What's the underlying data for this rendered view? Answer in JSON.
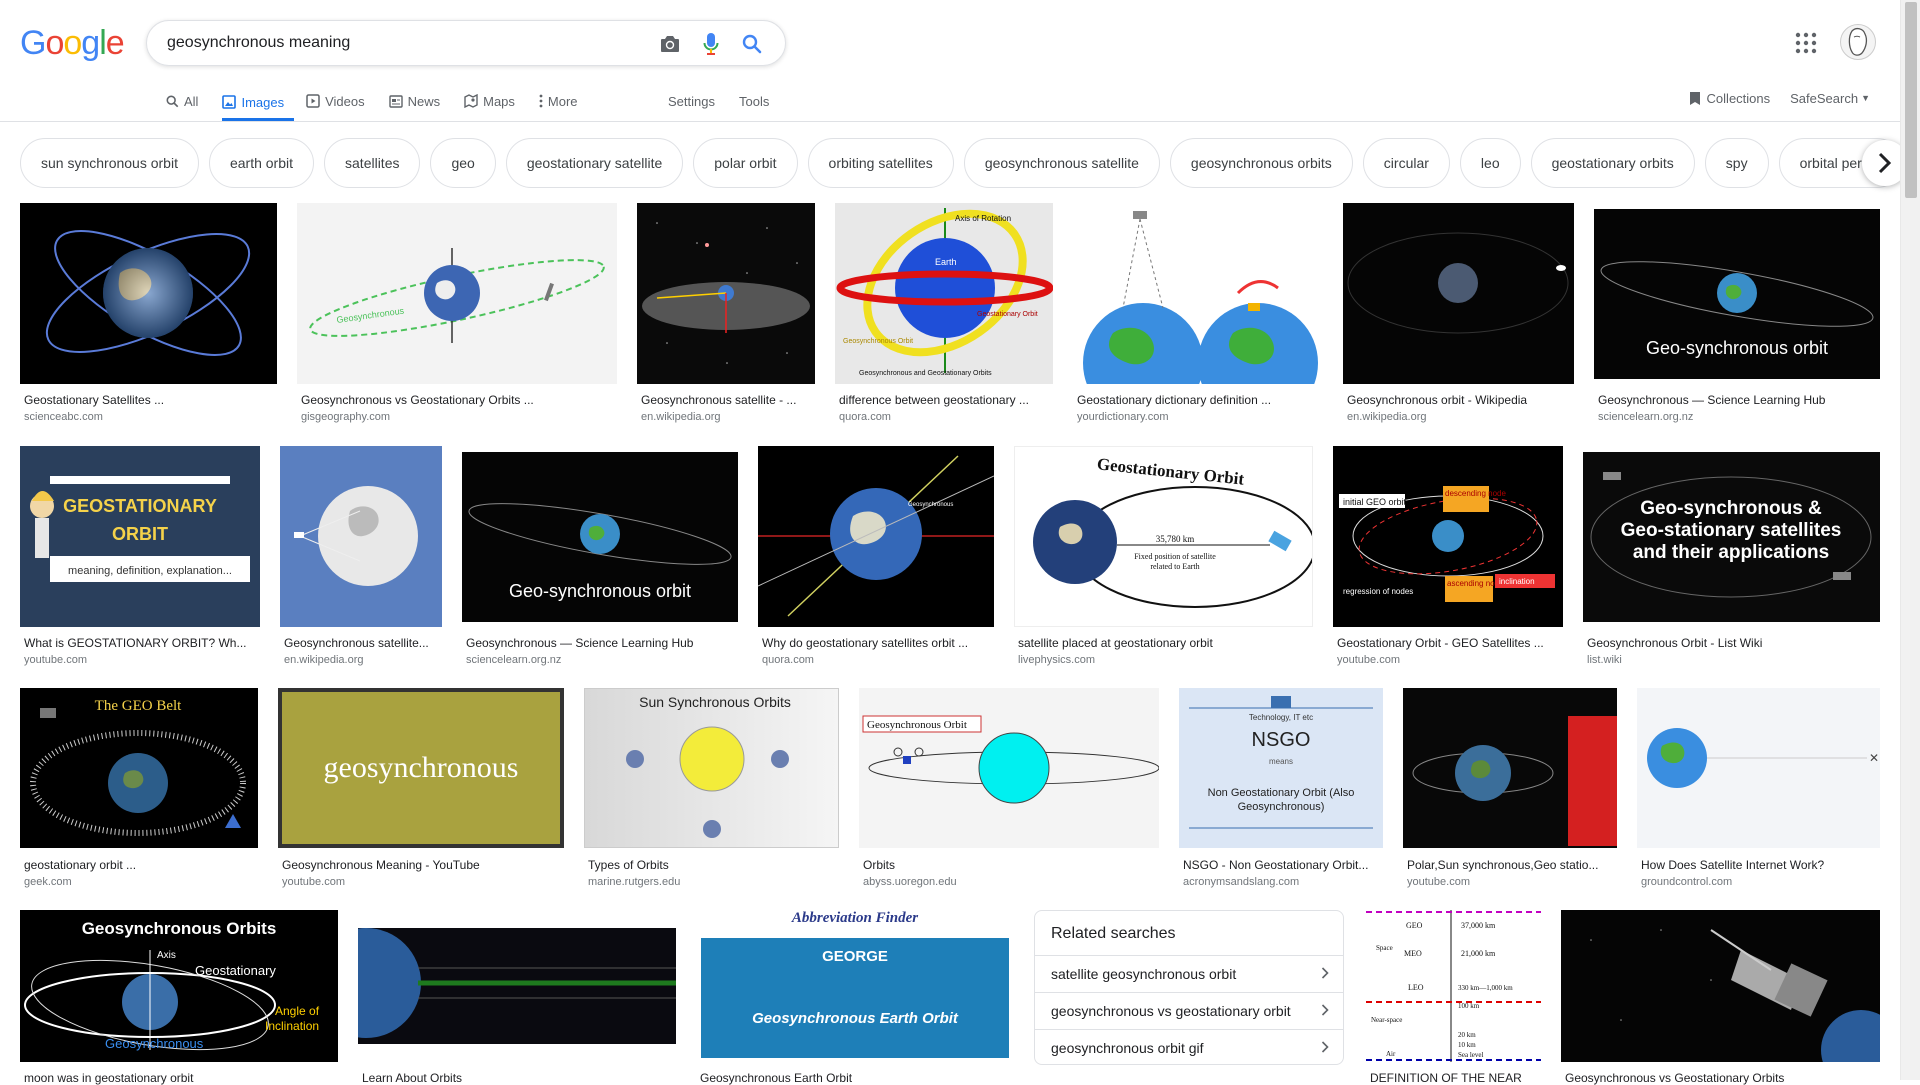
{
  "logo": {
    "letters": [
      "G",
      "o",
      "o",
      "g",
      "l",
      "e"
    ]
  },
  "search": {
    "query": "geosynchronous meaning",
    "icons": [
      "camera-icon",
      "microphone-icon",
      "search-icon"
    ]
  },
  "header_icons": {
    "apps": "grid-apps-icon",
    "avatar": "account-avatar"
  },
  "tabs": [
    {
      "label": "All",
      "icon": "search-icon"
    },
    {
      "label": "Images",
      "icon": "image-icon",
      "active": true
    },
    {
      "label": "Videos",
      "icon": "video-icon"
    },
    {
      "label": "News",
      "icon": "news-icon"
    },
    {
      "label": "Maps",
      "icon": "map-icon"
    },
    {
      "label": "More",
      "icon": "more-icon"
    }
  ],
  "tools": {
    "settings": "Settings",
    "tools": "Tools"
  },
  "right_tools": {
    "collections": "Collections",
    "safesearch": "SafeSearch"
  },
  "chips": [
    "sun synchronous orbit",
    "earth orbit",
    "satellites",
    "geo",
    "geostationary satellite",
    "polar orbit",
    "orbiting satellites",
    "geosynchronous satellite",
    "geosynchronous orbits",
    "circular",
    "leo",
    "geostationary orbits",
    "spy",
    "orbital period"
  ],
  "results": [
    {
      "caption": "Geostationary Satellites ...",
      "source": "scienceabc.com"
    },
    {
      "caption": "Geosynchronous vs Geostationary Orbits ...",
      "source": "gisgeography.com"
    },
    {
      "caption": "Geosynchronous satellite - ...",
      "source": "en.wikipedia.org"
    },
    {
      "caption": "difference between geostationary ...",
      "source": "quora.com"
    },
    {
      "caption": "Geostationary dictionary definition ...",
      "source": "yourdictionary.com"
    },
    {
      "caption": "Geosynchronous orbit - Wikipedia",
      "source": "en.wikipedia.org"
    },
    {
      "caption": "Geosynchronous — Science Learning Hub",
      "source": "sciencelearn.org.nz"
    },
    {
      "caption": "What is GEOSTATIONARY ORBIT? Wh...",
      "source": "youtube.com"
    },
    {
      "caption": "Geosynchronous satellite...",
      "source": "en.wikipedia.org"
    },
    {
      "caption": "Geosynchronous — Science Learning Hub",
      "source": "sciencelearn.org.nz"
    },
    {
      "caption": "Why do geostationary satellites orbit ...",
      "source": "quora.com"
    },
    {
      "caption": "satellite placed at geostationary orbit",
      "source": "livephysics.com"
    },
    {
      "caption": "Geostationary Orbit - GEO Satellites ...",
      "source": "youtube.com"
    },
    {
      "caption": "Geosynchronous Orbit - List Wiki",
      "source": "list.wiki"
    },
    {
      "caption": "geostationary orbit ...",
      "source": "geek.com"
    },
    {
      "caption": "Geosynchronous Meaning - YouTube",
      "source": "youtube.com"
    },
    {
      "caption": "Types of Orbits",
      "source": "marine.rutgers.edu"
    },
    {
      "caption": "Orbits",
      "source": "abyss.uoregon.edu"
    },
    {
      "caption": "NSGO - Non Geostationary Orbit...",
      "source": "acronymsandslang.com"
    },
    {
      "caption": "Polar,Sun synchronous,Geo statio...",
      "source": "youtube.com"
    },
    {
      "caption": "How Does Satellite Internet Work?",
      "source": "groundcontrol.com"
    },
    {
      "caption": "moon was in geostationary orbit",
      "source": ""
    },
    {
      "caption": "Learn About Orbits",
      "source": ""
    },
    {
      "caption": "Geosynchronous Earth Orbit",
      "source": ""
    },
    {
      "caption": "DEFINITION OF THE NEAR",
      "source": ""
    },
    {
      "caption": "Geosynchronous vs Geostationary Orbits",
      "source": ""
    }
  ],
  "thumb_text": {
    "geo_sync_orbit": "Geo-synchronous orbit",
    "geostationary": "GEOSTATIONARY",
    "orbit": "ORBIT",
    "meaning_def": "meaning, definition, explanation...",
    "geostationary_orbit": "Geostationary Orbit",
    "km_35780": "35,780 km",
    "fixed_position": "Fixed position of satellite",
    "related_to_earth": "related to Earth",
    "geo_sync_apps_1": "Geo-synchronous &",
    "geo_sync_apps_2": "Geo-stationary satellites",
    "geo_sync_apps_3": "and their applications",
    "the_geo_belt": "The GEO Belt",
    "geosynchronous_word": "geosynchronous",
    "sun_sync_orbits": "Sun Synchronous Orbits",
    "geosync_orbit_label": "Geosynchronous Orbit",
    "nsgo": "NSGO",
    "tech_it": "Technology, IT etc",
    "means": "means",
    "nsgo_def_1": "Non Geostationary Orbit (Also",
    "nsgo_def_2": "Geosynchronous)",
    "geosync_orbits_title": "Geosynchronous Orbits",
    "axis": "Axis",
    "geostationary_lbl": "Geostationary",
    "angle_of": "Angle of",
    "inclination": "Inclination",
    "geosynchronous_lbl": "Geosynchronous",
    "abbrev_finder": "Abbreviation Finder",
    "george": "GEORGE",
    "geo_earth_orbit": "Geosynchronous Earth Orbit",
    "axis_of_rotation": "Axis of Rotation",
    "earth": "Earth",
    "geostationary_orbit_small": "Geostationary Orbit",
    "geosynchronous_orbit_small": "Geosynchronous Orbit",
    "geo_and_geostat": "Geosynchronous and Geostationary Orbits",
    "geo_lbl": "GEO",
    "meo_lbl": "MEO",
    "leo_lbl": "LEO",
    "space_lbl": "Space",
    "near_space": "Near-space",
    "air_lbl": "Air",
    "km1": "37,000 km",
    "km2": "21,000 km",
    "km3": "330 km—1,000 km",
    "km4": "100 km",
    "km5": "20 km",
    "km6": "10 km",
    "sea_level": "Sea level",
    "geosynchronous_thin": "Geosynchronous",
    "initial_geo": "initial GEO orbit",
    "descending": "descending node",
    "ascending": "ascending node",
    "regression": "regression of nodes",
    "inclination_lbl": "inclination"
  },
  "related": {
    "title": "Related searches",
    "items": [
      "satellite geosynchronous orbit",
      "geosynchronous vs geostationary orbit",
      "geosynchronous orbit gif"
    ]
  },
  "colors": {
    "accent": "#1a73e8",
    "text_secondary": "#5f6368",
    "border": "#dfe1e5"
  }
}
